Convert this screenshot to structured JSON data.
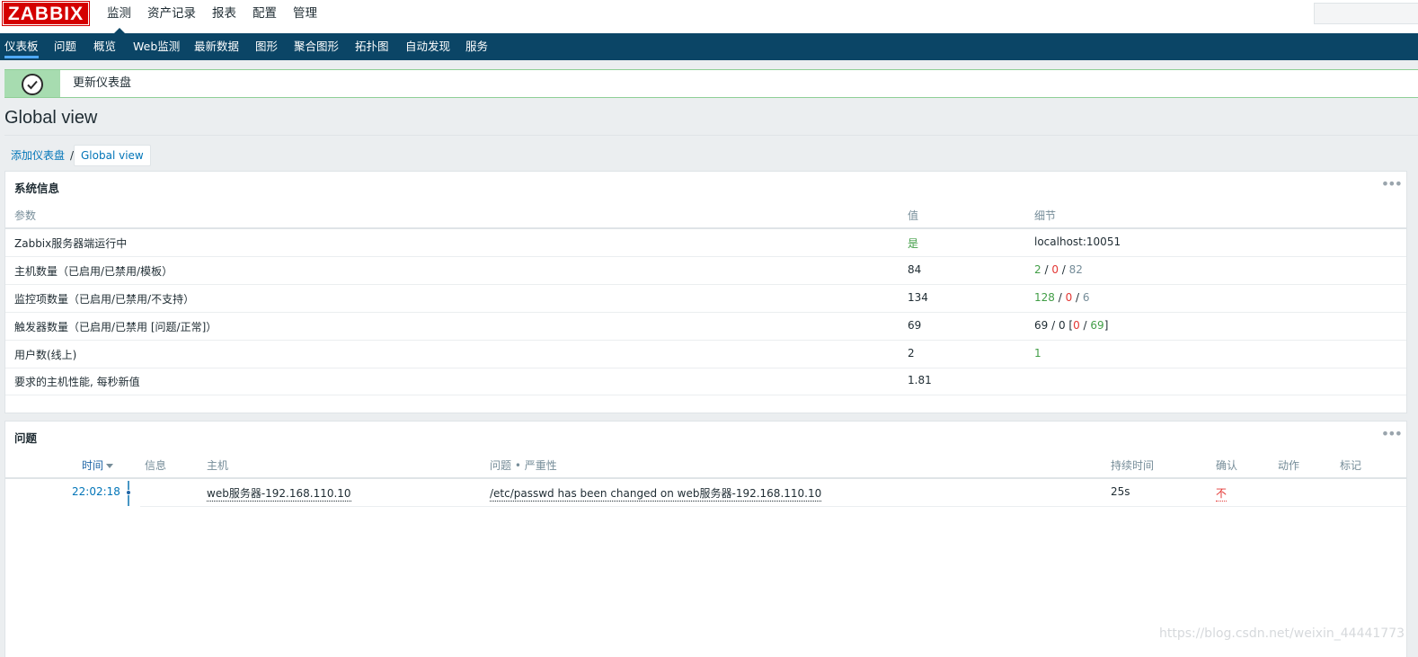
{
  "header": {
    "logo": "ZABBIX",
    "main_nav": [
      "监测",
      "资产记录",
      "报表",
      "配置",
      "管理"
    ],
    "active_main": 0,
    "search_value": ""
  },
  "subnav": {
    "items": [
      "仪表板",
      "问题",
      "概览",
      "Web监测",
      "最新数据",
      "图形",
      "聚合图形",
      "拓扑图",
      "自动发现",
      "服务"
    ],
    "active": 0
  },
  "message": {
    "text": "更新仪表盘"
  },
  "page": {
    "title": "Global view"
  },
  "breadcrumb": {
    "parent": "添加仪表盘",
    "separator": "/",
    "current": "Global view"
  },
  "system_info": {
    "title": "系统信息",
    "menu_icon": "ellipsis-icon",
    "headers": {
      "param": "参数",
      "value": "值",
      "details": "细节"
    },
    "rows": [
      {
        "param": "Zabbix服务器端运行中",
        "value": "是",
        "details_text": "localhost:10051"
      },
      {
        "param": "主机数量（已启用/已禁用/模板）",
        "value": "84",
        "d1": "2",
        "d2": "0",
        "d3": "82"
      },
      {
        "param": "监控项数量（已启用/已禁用/不支持）",
        "value": "134",
        "d1": "128",
        "d2": "0",
        "d3": "6"
      },
      {
        "param": "触发器数量（已启用/已禁用 [问题/正常]）",
        "value": "69",
        "d1": "69",
        "d2": "0",
        "d3": "0",
        "d4": "69"
      },
      {
        "param": "用户数(线上)",
        "value": "2",
        "d1": "1"
      },
      {
        "param": "要求的主机性能, 每秒新值",
        "value": "1.81"
      }
    ]
  },
  "problems": {
    "title": "问题",
    "menu_icon": "ellipsis-icon",
    "headers": {
      "time": "时间",
      "info": "信息",
      "host": "主机",
      "problem": "问题 • 严重性",
      "duration": "持续时间",
      "ack": "确认",
      "actions": "动作",
      "tags": "标记"
    },
    "rows": [
      {
        "time": "22:02:18",
        "host": "web服务器-192.168.110.10",
        "problem": "/etc/passwd has been changed on web服务器-192.168.110.10",
        "duration": "25s",
        "ack": "不"
      }
    ]
  },
  "watermark": "https://blog.csdn.net/weixin_44441773",
  "colors": {
    "brand": "#d40000",
    "nav_bg": "#0b4566",
    "link": "#0275b8",
    "ok_green": "#429e47",
    "problem_red": "#e33734",
    "success_bg": "#a7dcb0"
  }
}
